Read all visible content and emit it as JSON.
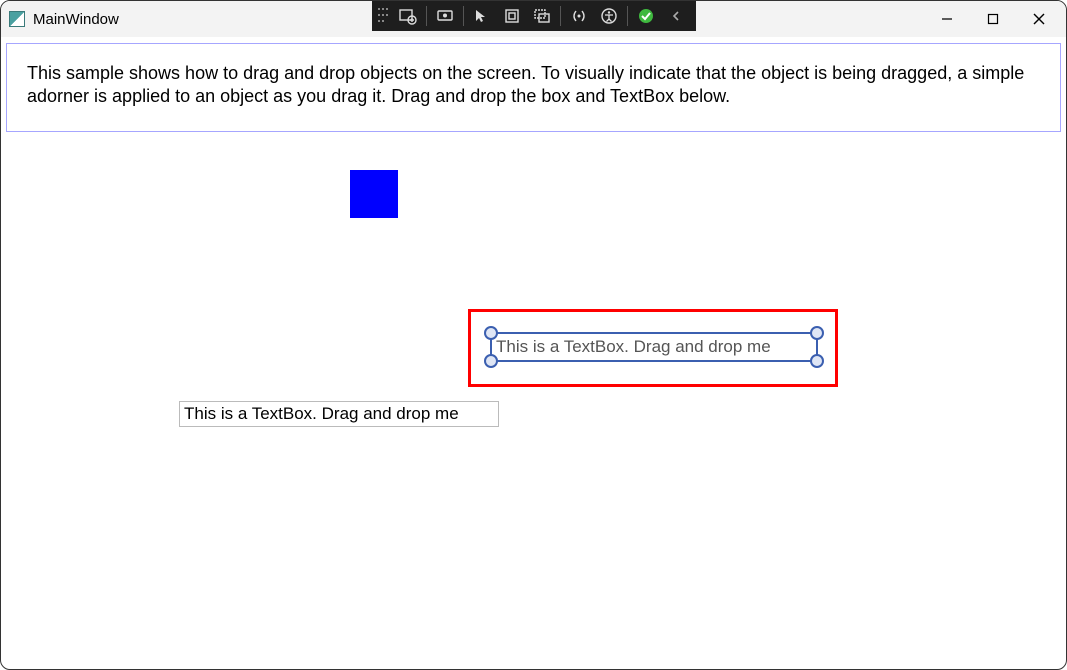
{
  "window": {
    "title": "MainWindow"
  },
  "info_panel": {
    "text": "This sample shows how to drag and drop objects on the screen. To visually indicate that the object is being dragged, a simple adorner is applied to an object as you drag it. Drag and drop the box and TextBox below."
  },
  "canvas": {
    "adorner_textbox_value": "This is a TextBox. Drag and drop me",
    "textbox_value": "This is a TextBox. Drag and drop me"
  },
  "vs_toolbar": {
    "icons": [
      "live-visual-tree",
      "screencast",
      "select-element",
      "display-layout-adorners",
      "track-focus",
      "xaml-binding",
      "accessibility",
      "hot-reload",
      "chevron-left"
    ]
  }
}
